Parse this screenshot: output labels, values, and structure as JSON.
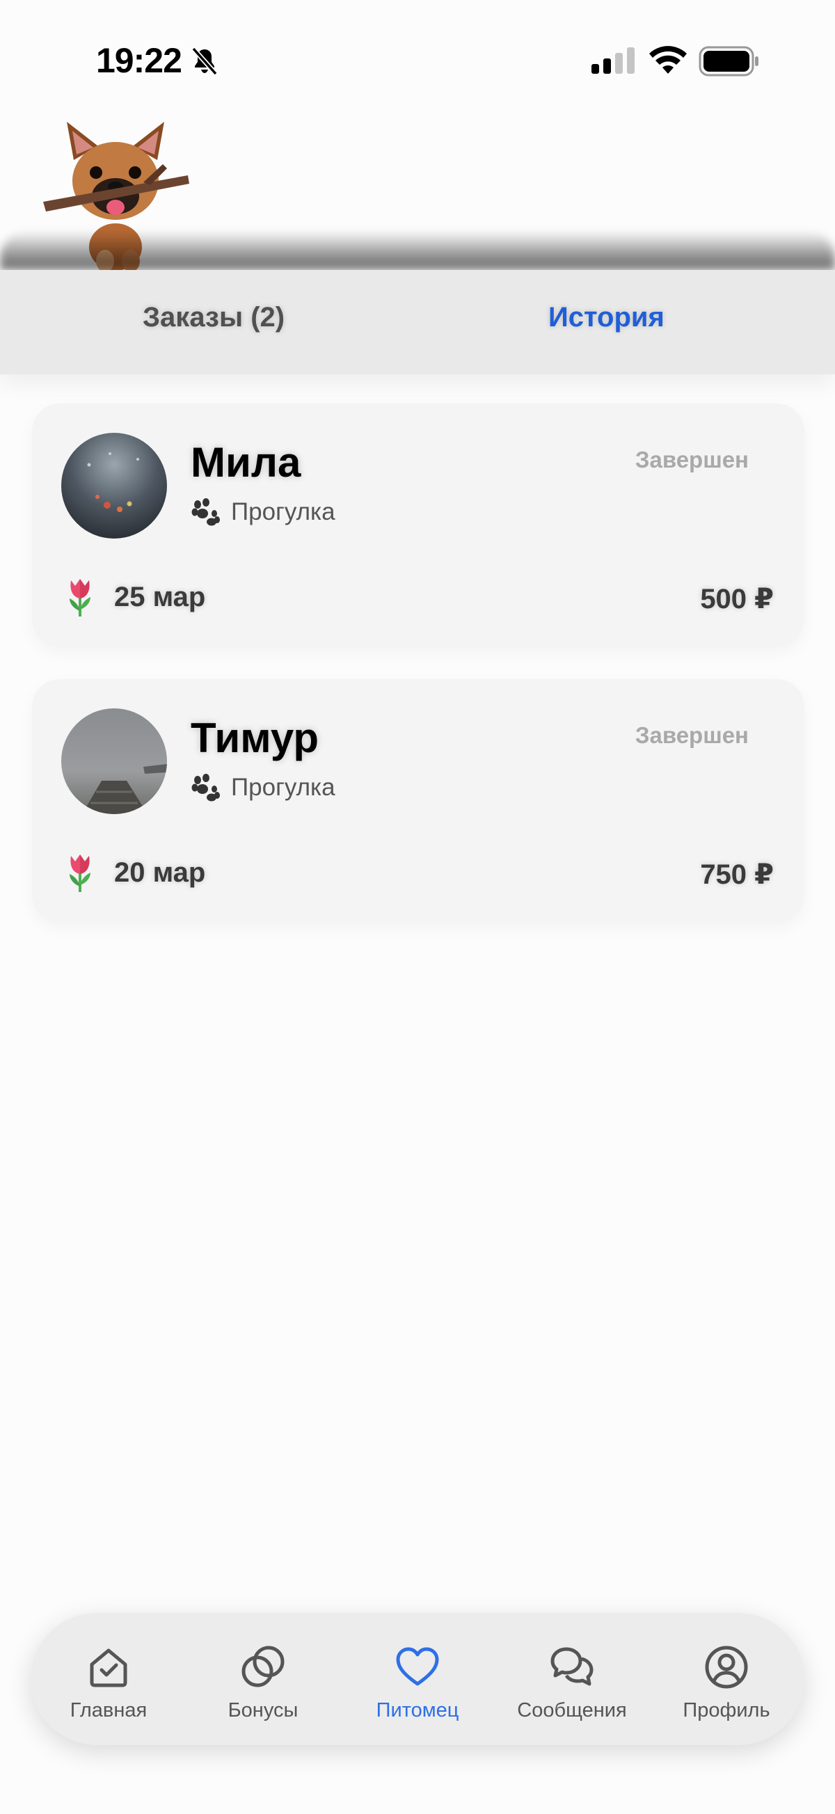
{
  "status_bar": {
    "time": "19:22"
  },
  "tabs": {
    "orders_label": "Заказы (2)",
    "history_label": "История",
    "active": "history"
  },
  "orders": [
    {
      "name": "Мила",
      "status": "Завершен",
      "service": "Прогулка",
      "date": "25 мар",
      "price": "500 ₽"
    },
    {
      "name": "Тимур",
      "status": "Завершен",
      "service": "Прогулка",
      "date": "20 мар",
      "price": "750 ₽"
    }
  ],
  "nav": {
    "items": [
      {
        "label": "Главная",
        "icon": "home-check-icon"
      },
      {
        "label": "Бонусы",
        "icon": "coins-icon"
      },
      {
        "label": "Питомец",
        "icon": "heart-icon"
      },
      {
        "label": "Сообщения",
        "icon": "chat-bubbles-icon"
      },
      {
        "label": "Профиль",
        "icon": "user-circle-icon"
      }
    ],
    "active_index": 2
  },
  "colors": {
    "accent": "#1f5ed8",
    "nav_active": "#2f6fe6",
    "status_done": "#a9a9a9"
  }
}
